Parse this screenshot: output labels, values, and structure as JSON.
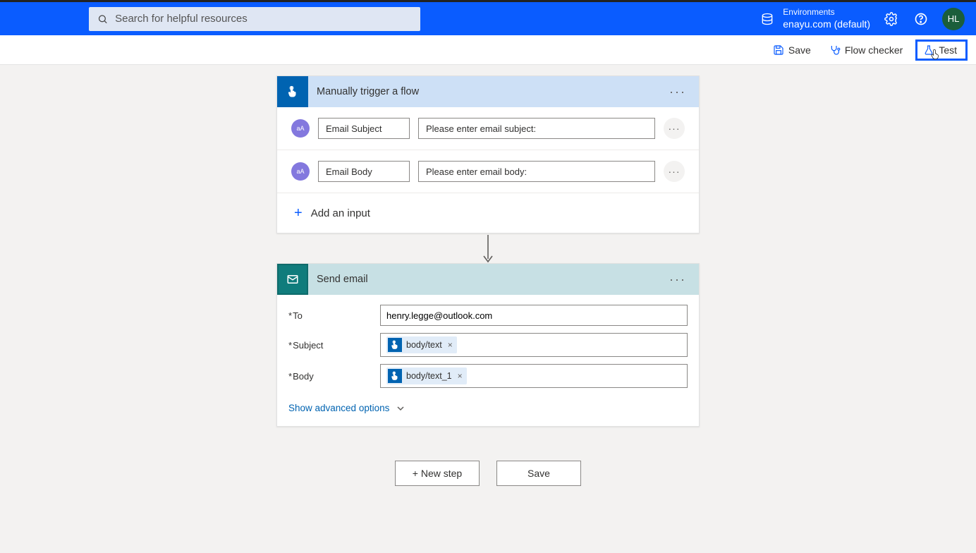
{
  "header": {
    "search_placeholder": "Search for helpful resources",
    "env_label": "Environments",
    "env_name": "enayu.com (default)",
    "avatar_initials": "HL"
  },
  "toolbar": {
    "save": "Save",
    "flow_checker": "Flow checker",
    "test": "Test"
  },
  "trigger": {
    "title": "Manually trigger a flow",
    "inputs": [
      {
        "name": "Email Subject",
        "prompt": "Please enter email subject:"
      },
      {
        "name": "Email Body",
        "prompt": "Please enter email body:"
      }
    ],
    "add_input": "Add an input"
  },
  "action": {
    "title": "Send email",
    "fields": {
      "to_label": "To",
      "to_value": "henry.legge@outlook.com",
      "subject_label": "Subject",
      "subject_token": "body/text",
      "body_label": "Body",
      "body_token": "body/text_1"
    },
    "advanced": "Show advanced options"
  },
  "footer": {
    "new_step": "+ New step",
    "save": "Save"
  }
}
